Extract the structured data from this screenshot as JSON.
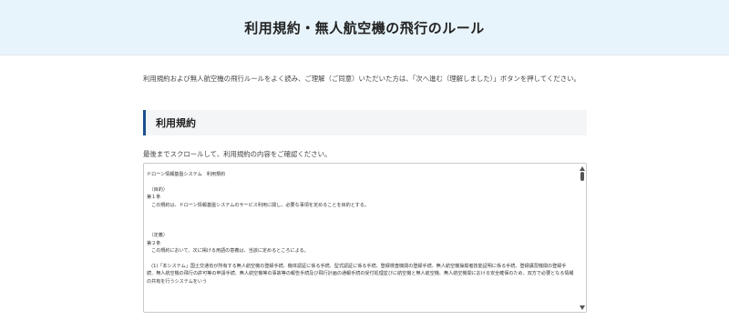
{
  "header": {
    "title": "利用規約・無人航空機の飛行のルール"
  },
  "intro": {
    "text": "利用規約および無人航空機の飛行ルールをよく読み、ご理解（ご同意）いただいた方は、「次へ進む（理解しました）」ボタンを押してください。"
  },
  "section": {
    "title": "利用規約"
  },
  "scroll_note": "最後までスクロールして、利用規約の内容をご確認ください。",
  "terms": {
    "lines": [
      "ドローン情報基盤システム　利用規約",
      "",
      "　（目的）",
      "第１条",
      "　この規約は、ドローン情報基盤システムのサービス利用に関し、必要な事項を定めることを目的とする。",
      "",
      "",
      "",
      "　（定義）",
      "第２条",
      "　この規約において、次に掲げる用語の意義は、当該に定めるところによる。",
      "",
      "　(1)「本システム」国土交通省が所有する無人航空機の登録手続、機体認証に係る手続、型式認証に係る手続、登録検査機関の登録手続、無人航空機操縦者技能証明に係る手続、登録講習機関の登録手続、無人航空機の飛行の許可等の申請手続、無人航空機等の事故等の報告手続及び飛行計画の通報手続の受付処理並びに航空機と無人航空機、無人航空機間における安全確保のため、双方で必要となる情報の共有を行うシステムをいう"
    ]
  },
  "colors": {
    "header_bg": "#e8f4fb",
    "section_accent": "#1b4f8c",
    "section_bg": "#f4f5f6"
  },
  "icons": {
    "scroll_up": "triangle-up-icon",
    "scroll_down": "triangle-down-icon"
  }
}
